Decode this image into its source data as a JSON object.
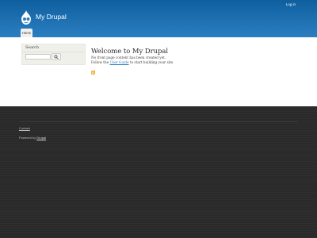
{
  "header": {
    "site_name": "My Drupal",
    "login": "Log in",
    "tab_home": "Home",
    "colors": {
      "top": "#0f5f9f",
      "bottom": "#2b7fc0"
    }
  },
  "sidebar": {
    "search_title": "Search",
    "search_icon": "search-icon"
  },
  "main": {
    "welcome": "Welcome to My Drupal",
    "line1": "No front page content has been created yet.",
    "line2_prefix": "Follow the",
    "line2_link": "User Guide",
    "line2_suffix": "to start building your site.",
    "rss_icon": "rss-icon"
  },
  "footer": {
    "contact": "Contact",
    "powered_prefix": "Powered by",
    "powered_link": "Drupal",
    "background": "#2a2a2a"
  }
}
